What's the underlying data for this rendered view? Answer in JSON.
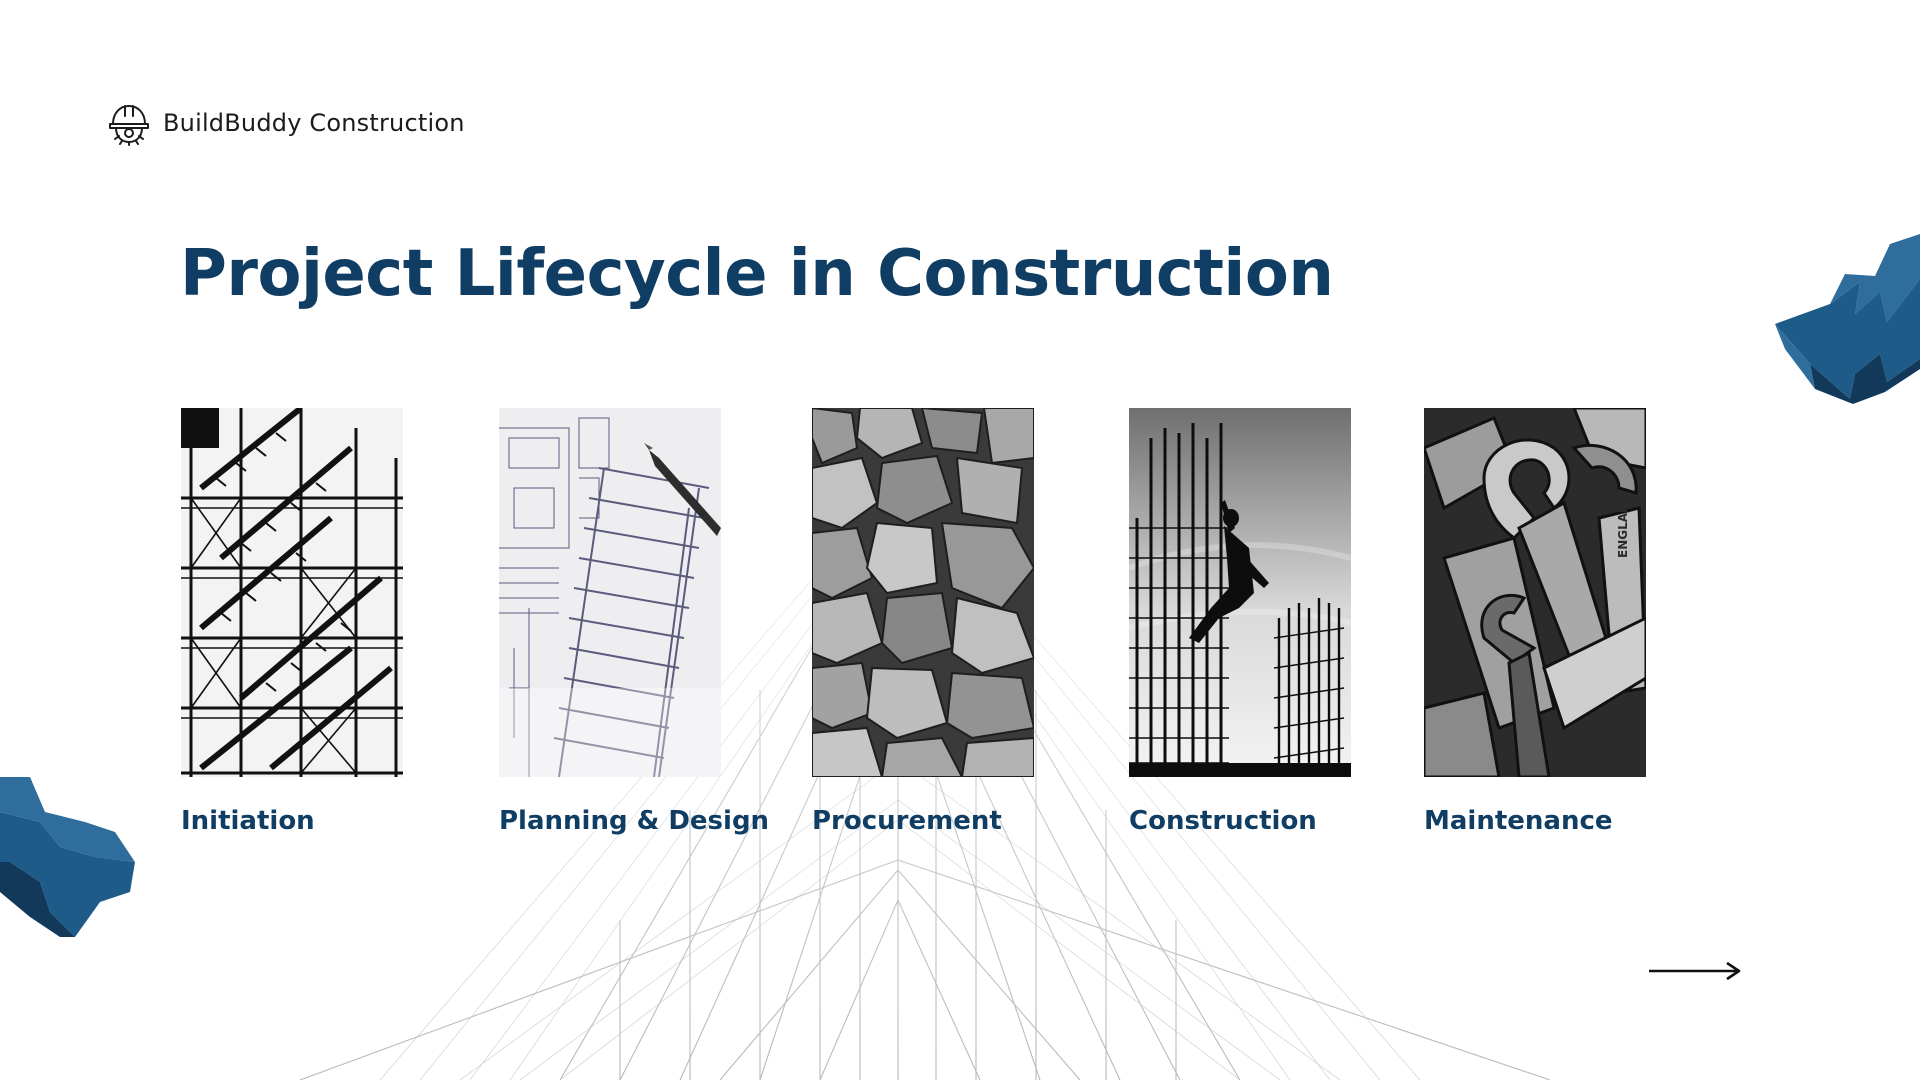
{
  "brand": {
    "name": "BuildBuddy Construction",
    "icon": "hardhat-gear-icon"
  },
  "slide": {
    "title": "Project Lifecycle in Construction"
  },
  "phases": [
    {
      "label": "Initiation",
      "image": "staircase-scaffold-photo"
    },
    {
      "label": "Planning & Design",
      "image": "blueprint-pen-photo"
    },
    {
      "label": "Procurement",
      "image": "gravel-rocks-photo"
    },
    {
      "label": "Construction",
      "image": "worker-climbing-rebar-photo"
    },
    {
      "label": "Maintenance",
      "image": "wrenches-photo"
    }
  ],
  "navigation": {
    "icon": "arrow-right-icon"
  },
  "colors": {
    "title": "#0f3d63",
    "accent": "#2e6d9c",
    "accent_dark": "#12395a",
    "text": "#1b1b1b",
    "background": "#ffffff"
  }
}
